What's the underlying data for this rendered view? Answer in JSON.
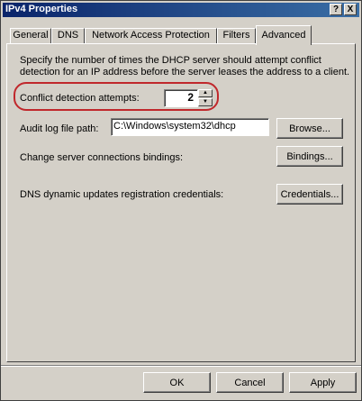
{
  "window": {
    "title": "IPv4 Properties",
    "help_button": "?",
    "close_button": "X"
  },
  "tabs": [
    {
      "label": "General"
    },
    {
      "label": "DNS"
    },
    {
      "label": "Network Access Protection"
    },
    {
      "label": "Filters"
    },
    {
      "label": "Advanced",
      "selected": true
    }
  ],
  "advanced": {
    "description_line1": "Specify the number of times the DHCP server should attempt conflict",
    "description_line2": "detection for an IP address before the server leases the address to a client.",
    "conflict_label": "Conflict detection attempts:",
    "conflict_value": "2",
    "audit_label": "Audit log file path:",
    "audit_value": "C:\\Windows\\system32\\dhcp",
    "browse_label": "Browse...",
    "bindings_text": "Change server connections bindings:",
    "bindings_label": "Bindings...",
    "credentials_text": "DNS dynamic updates registration credentials:",
    "credentials_label": "Credentials..."
  },
  "footer": {
    "ok_label": "OK",
    "cancel_label": "Cancel",
    "apply_label": "Apply"
  },
  "colors": {
    "title_bar": "#0a246a",
    "dialog_face": "#d4d0c8",
    "highlight_ring": "#c0282c"
  }
}
